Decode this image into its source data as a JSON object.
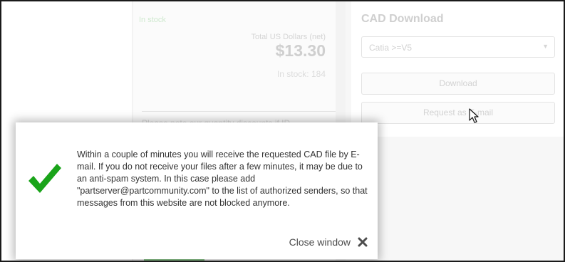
{
  "product": {
    "stock_status": "In stock",
    "total_label": "Total US Dollars (net)",
    "price": "$13.30",
    "stock_count": "In stock: 184",
    "note": "Please note our quantity discounts if ID..."
  },
  "cad": {
    "title": "CAD Download",
    "format_selected": "Catia >=V5",
    "download_label": "Download",
    "request_email_label": "Request as E-mail"
  },
  "modal": {
    "message": "Within a couple of minutes you will receive the requested CAD file by E-mail. If you do not receive your files after a few minutes, it may be due to an anti-spam system. In this case please add \"partserver@partcommunity.com\" to the list of authorized senders, so that messages from this website are not blocked anymore.",
    "close_label": "Close window"
  },
  "icons": {
    "success": "checkmark-icon",
    "close": "close-icon",
    "dropdown": "chevron-down-icon",
    "cursor": "mouse-cursor-icon"
  },
  "colors": {
    "success": "#1aa41a",
    "close": "#4d4d4d"
  }
}
